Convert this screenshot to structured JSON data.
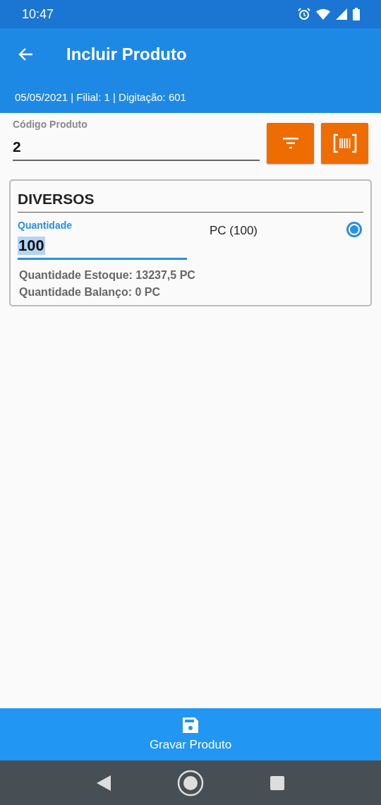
{
  "status_bar": {
    "time": "10:47"
  },
  "app_bar": {
    "title": "Incluir Produto"
  },
  "info_bar": {
    "text": "05/05/2021 | Filial: 1 | Digitação: 601"
  },
  "product_code": {
    "label": "Código Produto",
    "value": "2"
  },
  "product_card": {
    "title": "DIVERSOS",
    "quantity": {
      "label": "Quantidade",
      "value": "100",
      "highlighted": true,
      "focused": true
    },
    "units": [
      {
        "label": "PC (100)",
        "selected": true
      }
    ],
    "details": [
      "Quantidade Estoque: 13237,5 PC",
      "Quantidade Balanço: 0 PC"
    ]
  },
  "bottom_button": {
    "label": "Gravar Produto"
  }
}
